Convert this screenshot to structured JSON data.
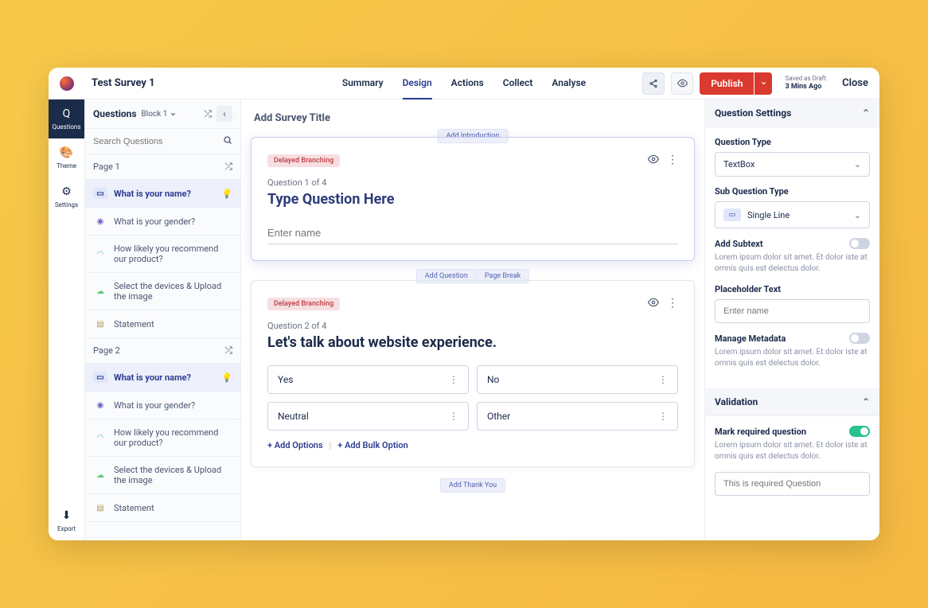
{
  "header": {
    "title": "Test Survey 1",
    "tabs": [
      "Summary",
      "Design",
      "Actions",
      "Collect",
      "Analyse"
    ],
    "active_tab": 1,
    "publish": "Publish",
    "saved_as": "Saved as Draft",
    "saved_time": "3 Mins Ago",
    "close": "Close"
  },
  "rail": {
    "items": [
      {
        "label": "Questions",
        "active": true
      },
      {
        "label": "Theme",
        "active": false
      },
      {
        "label": "Settings",
        "active": false
      }
    ],
    "export": "Export"
  },
  "sidebar": {
    "title": "Questions",
    "block": "Block 1",
    "search_placeholder": "Search Questions",
    "pages": [
      {
        "label": "Page 1",
        "items": [
          {
            "type": "text",
            "label": "What is your name?",
            "active": true,
            "bulb": true
          },
          {
            "type": "radio",
            "label": "What is your gender?"
          },
          {
            "type": "nps",
            "label": "How likely you recommend our product?"
          },
          {
            "type": "upload",
            "label": "Select the devices & Upload the image"
          },
          {
            "type": "stmt",
            "label": "Statement"
          }
        ]
      },
      {
        "label": "Page 2",
        "items": [
          {
            "type": "text",
            "label": "What is your name?",
            "active": true,
            "bulb": true
          },
          {
            "type": "radio",
            "label": "What is your gender?"
          },
          {
            "type": "nps",
            "label": "How likely you recommend our product?"
          },
          {
            "type": "upload",
            "label": "Select the devices & Upload the image"
          },
          {
            "type": "stmt",
            "label": "Statement"
          }
        ]
      }
    ]
  },
  "editor": {
    "title": "Add Survey Title",
    "intro_pill": "Add Introduction",
    "add_question": "Add Question",
    "page_break": "Page Break",
    "thankyou_pill": "Add Thank You",
    "q1": {
      "badge": "Delayed Branching",
      "num": "Question 1 of 4",
      "title": "Type Question Here",
      "placeholder": "Enter name"
    },
    "q2": {
      "badge": "Delayed Branching",
      "num": "Question 2 of 4",
      "title": "Let's talk about website experience.",
      "options": [
        "Yes",
        "No",
        "Neutral",
        "Other"
      ],
      "add_options": "+ Add Options",
      "add_bulk": "+ Add Bulk Option"
    }
  },
  "settings": {
    "head": "Question Settings",
    "qtype_label": "Question Type",
    "qtype_value": "TextBox",
    "subtype_label": "Sub Question Type",
    "subtype_value": "Single Line",
    "subtext_label": "Add Subtext",
    "subtext_hint": "Lorem ipsum dolor sit amet. Et dolor iste at omnis quis est delectus dolor.",
    "placeholder_label": "Placeholder Text",
    "placeholder_value": "Enter name",
    "metadata_label": "Manage Metadata",
    "metadata_hint": "Lorem ipsum dolor sit amet. Et dolor iste at omnis quis est delectus dolor.",
    "validation_head": "Validation",
    "required_label": "Mark required question",
    "required_hint": "Lorem ipsum dolor sit amet. Et dolor iste at omnis quis est delectus dolor.",
    "required_msg": "This is required Question"
  }
}
